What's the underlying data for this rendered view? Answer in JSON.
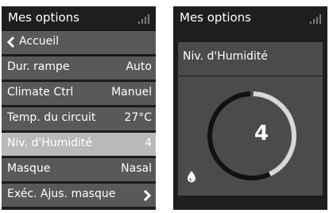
{
  "left_screen": {
    "title": "Mes options",
    "menu": [
      {
        "label": "Accueil",
        "value": "",
        "type": "back"
      },
      {
        "label": "Dur. rampe",
        "value": "Auto"
      },
      {
        "label": "Climate Ctrl",
        "value": "Manuel"
      },
      {
        "label": "Temp. du circuit",
        "value": "27°C"
      },
      {
        "label": "Niv. d'Humidité",
        "value": "4",
        "selected": true
      },
      {
        "label": "Masque",
        "value": "Nasal"
      },
      {
        "label": "Exéc. Ajus. masque",
        "value": "",
        "type": "submenu"
      }
    ]
  },
  "right_screen": {
    "title": "Mes options",
    "setting_label": "Niv. d'Humidité",
    "humidity_level": "4",
    "dial_fill_fraction": 0.57
  },
  "colors": {
    "screen_bg": "#1e1e1e",
    "item_bg": "#595959",
    "selected_bg": "#b9b9b9",
    "panel_bg": "#4b4b4b",
    "dial_fill": "#111111",
    "dial_track": "#d8d8d8"
  },
  "icons": [
    "signal-strength-icon",
    "chevron-left-icon",
    "chevron-right-icon",
    "water-drop-icon"
  ]
}
